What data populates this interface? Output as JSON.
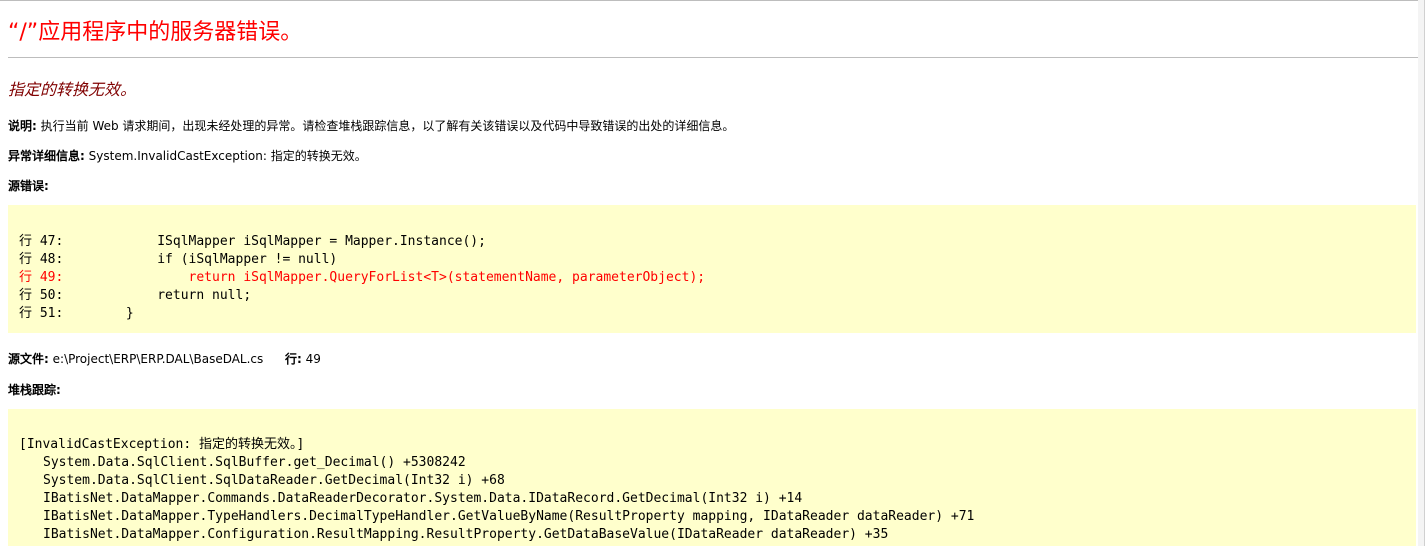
{
  "error_page": {
    "title": "“/”应用程序中的服务器错误。",
    "message": "指定的转换无效。",
    "description_label": "说明:",
    "description_text": "执行当前 Web 请求期间，出现未经处理的异常。请检查堆栈跟踪信息，以了解有关该错误以及代码中导致错误的出处的详细信息。",
    "exception_label": "异常详细信息:",
    "exception_text": "System.InvalidCastException: 指定的转换无效。",
    "source_error_label": "源错误:",
    "source_lines": [
      {
        "text": "行 47:            ISqlMapper iSqlMapper = Mapper.Instance();",
        "error": false
      },
      {
        "text": "行 48:            if (iSqlMapper != null)",
        "error": false
      },
      {
        "text": "行 49:                return iSqlMapper.QueryForList<T>(statementName, parameterObject);",
        "error": true
      },
      {
        "text": "行 50:            return null;",
        "error": false
      },
      {
        "text": "行 51:        }",
        "error": false
      }
    ],
    "source_file_label": "源文件:",
    "source_file_path": "e:\\Project\\ERP\\ERP.DAL\\BaseDAL.cs",
    "line_label": "行:",
    "line_number": "49",
    "stack_trace_label": "堆栈跟踪:",
    "stack_header": "[InvalidCastException: 指定的转换无效。]",
    "stack_lines": [
      "System.Data.SqlClient.SqlBuffer.get_Decimal() +5308242",
      "System.Data.SqlClient.SqlDataReader.GetDecimal(Int32 i) +68",
      "IBatisNet.DataMapper.Commands.DataReaderDecorator.System.Data.IDataRecord.GetDecimal(Int32 i) +14",
      "IBatisNet.DataMapper.TypeHandlers.DecimalTypeHandler.GetValueByName(ResultProperty mapping, IDataReader dataReader) +71",
      "IBatisNet.DataMapper.Configuration.ResultMapping.ResultProperty.GetDataBaseValue(IDataReader dataReader) +35"
    ],
    "colors": {
      "title": "#ff0000",
      "message": "#800000",
      "code_background": "#ffffcc",
      "error_line": "#ff0000"
    }
  }
}
